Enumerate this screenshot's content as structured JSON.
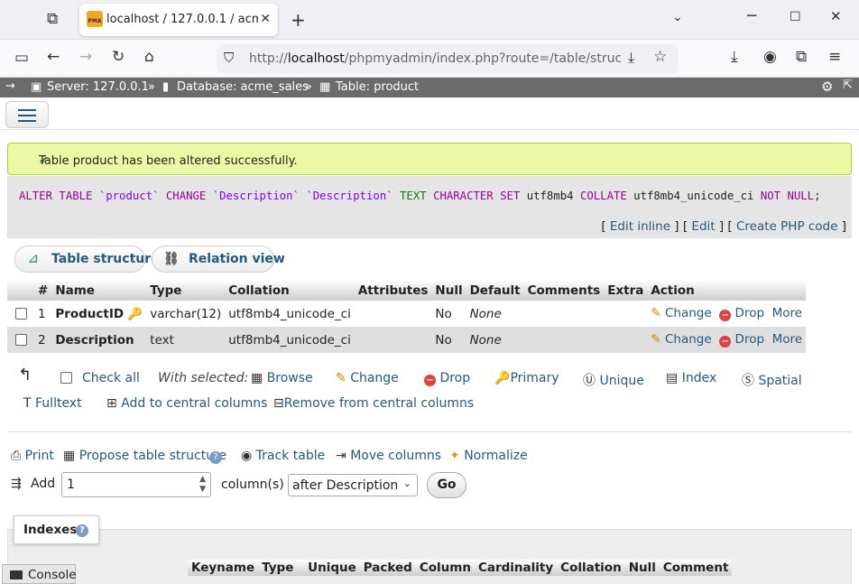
{
  "browser": {
    "tab_title": "localhost / 127.0.0.1 / acme_sales",
    "tab_logo": "PMA",
    "url_prefix": "http://",
    "url_host": "localhost",
    "url_path": "/phpmyadmin/index.php?route=/table/structure/save"
  },
  "breadcrumb": {
    "server": "Server: 127.0.0.1",
    "database": "Database: acme_sales",
    "table": "Table: product",
    "separator": "»"
  },
  "message": {
    "success": "Table product has been altered successfully.",
    "sql_tokens": [
      {
        "t": "ALTER TABLE",
        "c": "kw"
      },
      {
        "t": " ",
        "c": ""
      },
      {
        "t": "`product`",
        "c": "tn"
      },
      {
        "t": " ",
        "c": ""
      },
      {
        "t": "CHANGE",
        "c": "kw"
      },
      {
        "t": " ",
        "c": ""
      },
      {
        "t": "`Description`",
        "c": "tn"
      },
      {
        "t": " ",
        "c": ""
      },
      {
        "t": "`Description`",
        "c": "tn"
      },
      {
        "t": " ",
        "c": ""
      },
      {
        "t": "TEXT",
        "c": "ty"
      },
      {
        "t": " ",
        "c": ""
      },
      {
        "t": "CHARACTER SET",
        "c": "kw"
      },
      {
        "t": " utf8mb4 ",
        "c": ""
      },
      {
        "t": "COLLATE",
        "c": "kw"
      },
      {
        "t": " utf8mb4_unicode_ci ",
        "c": ""
      },
      {
        "t": "NOT NULL",
        "c": "kw"
      },
      {
        "t": ";",
        "c": ""
      }
    ],
    "edit_inline": "Edit inline",
    "edit": "Edit",
    "create_php": "Create PHP code"
  },
  "subtabs": {
    "structure": "Table structure",
    "relation": "Relation view"
  },
  "columns_table": {
    "headers": [
      "#",
      "Name",
      "Type",
      "Collation",
      "Attributes",
      "Null",
      "Default",
      "Comments",
      "Extra",
      "Action"
    ],
    "rows": [
      {
        "num": "1",
        "name": "ProductID",
        "type": "varchar(12)",
        "collation": "utf8mb4_unicode_ci",
        "attributes": "",
        "null": "No",
        "default": "None",
        "comments": "",
        "extra": ""
      },
      {
        "num": "2",
        "name": "Description",
        "type": "text",
        "collation": "utf8mb4_unicode_ci",
        "attributes": "",
        "null": "No",
        "default": "None",
        "comments": "",
        "extra": ""
      }
    ],
    "change": "Change",
    "drop": "Drop",
    "more": "More"
  },
  "with_selected": {
    "check_all": "Check all",
    "label": "With selected:",
    "browse": "Browse",
    "change": "Change",
    "drop": "Drop",
    "primary": "Primary",
    "unique": "Unique",
    "index": "Index",
    "spatial": "Spatial",
    "fulltext": "Fulltext",
    "add_central": "Add to central columns",
    "remove_central": "Remove from central columns"
  },
  "tools": {
    "print": "Print",
    "propose": "Propose table structure",
    "track": "Track table",
    "move": "Move columns",
    "normalize": "Normalize"
  },
  "add_columns": {
    "label": "Add",
    "count": "1",
    "suffix": "column(s)",
    "position": "after Description",
    "go": "Go"
  },
  "indexes": {
    "title": "Indexes",
    "headers": [
      "Keyname",
      "Type",
      "Unique",
      "Packed",
      "Column",
      "Cardinality",
      "Collation",
      "Null",
      "Comment"
    ]
  },
  "console": "Console"
}
